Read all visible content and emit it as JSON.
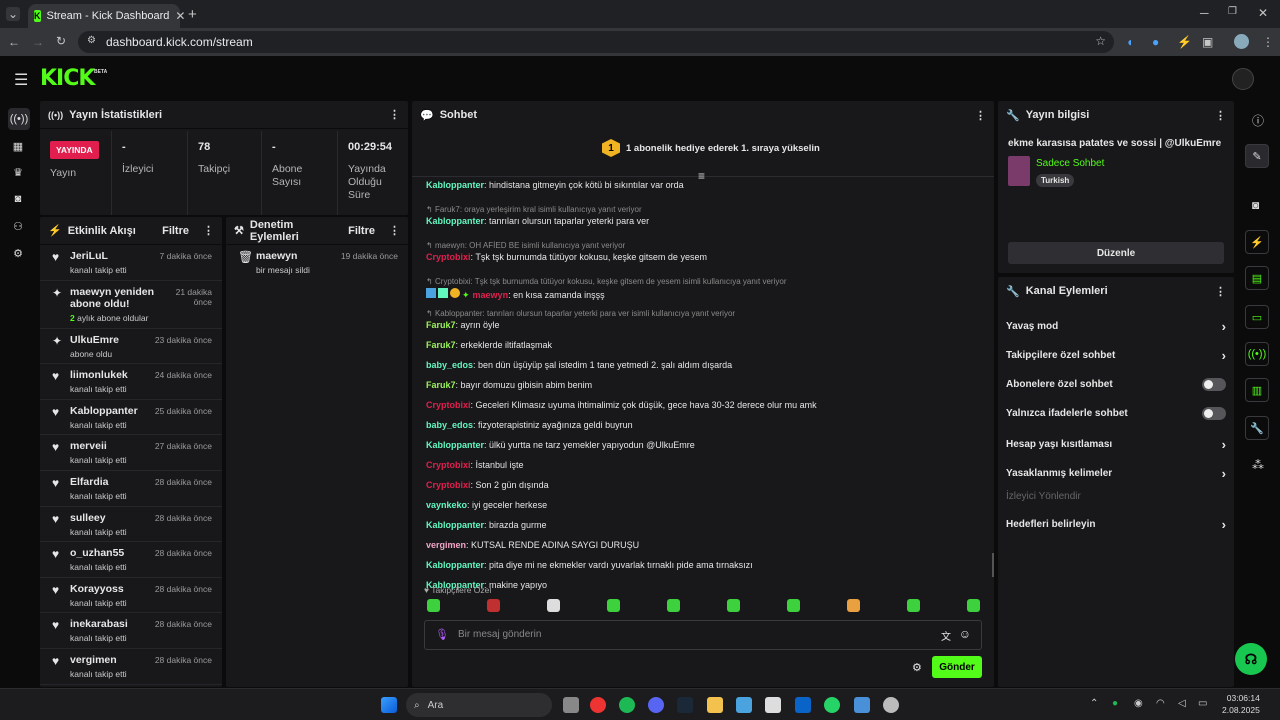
{
  "browser": {
    "tab_title": "Stream - Kick Dashboard",
    "url": "dashboard.kick.com/stream"
  },
  "header": {
    "logo": "KICK",
    "logo_badge": "BETA"
  },
  "stats": {
    "title": "Yayın İstatistikleri",
    "live_badge": "YAYINDA",
    "live_label": "Yayın",
    "items": [
      {
        "value": "-",
        "label": "İzleyici"
      },
      {
        "value": "78",
        "label": "Takipçi"
      },
      {
        "value": "-",
        "label": "Abone Sayısı"
      },
      {
        "value": "00:29:54",
        "label": "Yayında Olduğu Süre"
      }
    ]
  },
  "activity": {
    "title": "Etkinlik Akışı",
    "filter": "Filtre",
    "items": [
      {
        "name": "JeriLuL",
        "sub": "kanalı takip etti",
        "time": "7 dakika önce",
        "icon": "heart"
      },
      {
        "name": "maewyn yeniden abone oldu!",
        "sub_accent": "2",
        "sub": " aylık abone oldular",
        "time": "21 dakika önce",
        "icon": "sparkle"
      },
      {
        "name": "UlkuEmre",
        "sub": "abone oldu",
        "time": "23 dakika önce",
        "icon": "sparkle"
      },
      {
        "name": "liimonlukek",
        "sub": "kanalı takip etti",
        "time": "24 dakika önce",
        "icon": "heart"
      },
      {
        "name": "Kabloppanter",
        "sub": "kanalı takip etti",
        "time": "25 dakika önce",
        "icon": "heart"
      },
      {
        "name": "merveii",
        "sub": "kanalı takip etti",
        "time": "27 dakika önce",
        "icon": "heart"
      },
      {
        "name": "Elfardia",
        "sub": "kanalı takip etti",
        "time": "28 dakika önce",
        "icon": "heart"
      },
      {
        "name": "sulleey",
        "sub": "kanalı takip etti",
        "time": "28 dakika önce",
        "icon": "heart"
      },
      {
        "name": "o_uzhan55",
        "sub": "kanalı takip etti",
        "time": "28 dakika önce",
        "icon": "heart"
      },
      {
        "name": "Korayyoss",
        "sub": "kanalı takip etti",
        "time": "28 dakika önce",
        "icon": "heart"
      },
      {
        "name": "inekarabasi",
        "sub": "kanalı takip etti",
        "time": "28 dakika önce",
        "icon": "heart"
      },
      {
        "name": "vergimen",
        "sub": "kanalı takip etti",
        "time": "28 dakika önce",
        "icon": "heart"
      }
    ]
  },
  "moderation": {
    "title": "Denetim Eylemleri",
    "filter": "Filtre",
    "items": [
      {
        "name": "maewyn",
        "sub": "bir mesajı sildi",
        "time": "19 dakika önce"
      }
    ]
  },
  "chat": {
    "title": "Sohbet",
    "gift_rank": "1",
    "gift_text": "1 abonelik hediye ederek 1. sıraya yükselin",
    "lines": [
      {
        "type": "msg",
        "user": "Kabloppanter",
        "color": "c-grn",
        "text": ": hindistana gitmeyin çok kötü bi sıkıntılar var orda"
      },
      {
        "type": "reply",
        "text": "Faruk7: oraya yerleşirim kral isimli kullanıcıya yanıt veriyor"
      },
      {
        "type": "msg",
        "user": "Kabloppanter",
        "color": "c-grn",
        "text": ": tanrıları olursun taparlar yeterki para ver"
      },
      {
        "type": "reply",
        "text": "maewyn: OH AFİED BE isimli kullanıcıya yanıt veriyor"
      },
      {
        "type": "msg",
        "user": "Cryptobixi",
        "color": "c-red",
        "text": ": Tşk tşk burnumda tütüyor kokusu, keşke gitsem de yesem"
      },
      {
        "type": "reply",
        "text": "Cryptobixi: Tşk tşk burnumda tütüyor kokusu, keşke gitsem de yesem isimli kullanıcıya yanıt veriyor"
      },
      {
        "type": "msg",
        "user": "maewyn",
        "color": "c-red",
        "text": ": en kısa zamanda inşşş"
      },
      {
        "type": "reply",
        "text": "Kabloppanter: tanrıları olursun taparlar yeterki para ver isimli kullanıcıya yanıt veriyor"
      },
      {
        "type": "msg",
        "user": "Faruk7",
        "color": "c-lg",
        "text": ": ayrın öyle"
      },
      {
        "type": "msg",
        "user": "Faruk7",
        "color": "c-lg",
        "text": ": erkeklerde iltifatlaşmak"
      },
      {
        "type": "msg",
        "user": "baby_edos",
        "color": "c-grn",
        "text": ": ben dün üşüyüp şal istedim 1 tane yetmedi 2. şalı aldım dışarda"
      },
      {
        "type": "msg",
        "user": "Faruk7",
        "color": "c-lg",
        "text": ": bayır domuzu gibisin abim benim"
      },
      {
        "type": "msg",
        "user": "Cryptobixi",
        "color": "c-red",
        "text": ": Geceleri Klimasız uyuma ihtimalimiz çok düşük, gece hava 30-32 derece olur mu amk"
      },
      {
        "type": "msg",
        "user": "baby_edos",
        "color": "c-grn",
        "text": ": fizyoterapistiniz ayağınıza geldi buyrun"
      },
      {
        "type": "msg",
        "user": "Kabloppanter",
        "color": "c-grn",
        "text": ": ülkü yurtta ne tarz yemekler yapıyodun @UlkuEmre"
      },
      {
        "type": "msg",
        "user": "Cryptobixi",
        "color": "c-red",
        "text": ": İstanbul işte"
      },
      {
        "type": "msg",
        "user": "Cryptobixi",
        "color": "c-red",
        "text": ": Son 2 gün dışında"
      },
      {
        "type": "msg",
        "user": "vaynkeko",
        "color": "c-grn",
        "text": ": iyi geceler herkese"
      },
      {
        "type": "msg",
        "user": "Kabloppanter",
        "color": "c-grn",
        "text": ": birazda gurme"
      },
      {
        "type": "msg",
        "user": "vergimen",
        "color": "c-pink",
        "text": ": KUTSAL RENDE ADINA SAYGI DURUŞU"
      },
      {
        "type": "msg",
        "user": "Kabloppanter",
        "color": "c-grn",
        "text": ": pita diye mi ne ekmekler vardı yuvarlak tırnaklı pide ama tırnaksızı"
      },
      {
        "type": "msg",
        "user": "Kabloppanter",
        "color": "c-grn",
        "text": ": makine yapıyo"
      }
    ],
    "followers_only": "Takipçilere Özel",
    "input_placeholder": "Bir mesaj gönderin",
    "send": "Gönder"
  },
  "stream_info": {
    "title": "Yayın bilgisi",
    "stream_title": "ekme karasısa patates ve sossi | @UlkuEmre",
    "category": "Sadece Sohbet",
    "tag": "Turkish",
    "edit": "Düzenle"
  },
  "channel_actions": {
    "title": "Kanal Eylemleri",
    "items": [
      {
        "label": "Yavaş mod",
        "kind": "arrow"
      },
      {
        "label": "Takipçilere özel sohbet",
        "kind": "arrow"
      },
      {
        "label": "Abonelere özel sohbet",
        "kind": "toggle"
      },
      {
        "label": "Yalnızca ifadelerle sohbet",
        "kind": "toggle"
      },
      {
        "label": "Hesap yaşı kısıtlaması",
        "kind": "arrow"
      },
      {
        "label": "Yasaklanmış kelimeler",
        "kind": "arrow"
      },
      {
        "label": "İzleyici Yönlendir",
        "kind": "disabled"
      },
      {
        "label": "Hedefleri belirleyin",
        "kind": "arrow"
      }
    ]
  },
  "taskbar": {
    "search": "Ara",
    "time": "03:06:14",
    "date": "2.08.2025"
  },
  "colors": {
    "accent": "#53fc18",
    "live": "#e21e4e",
    "panel": "#18181b"
  }
}
